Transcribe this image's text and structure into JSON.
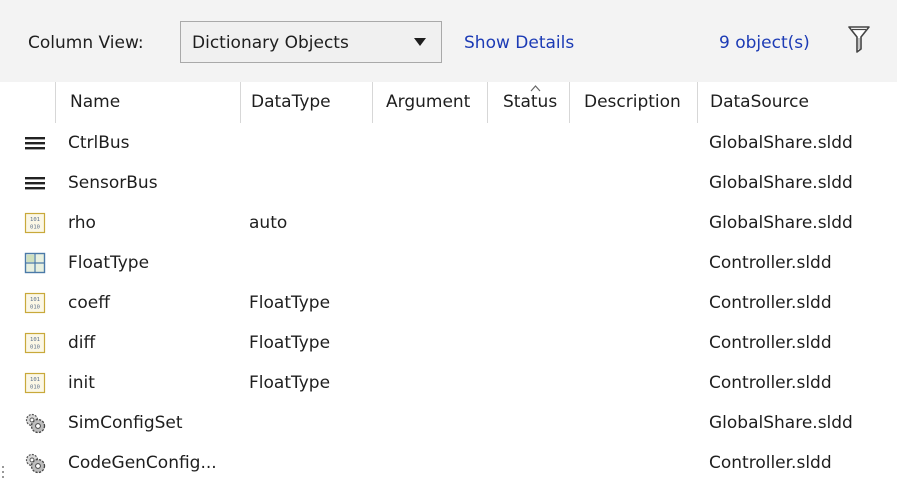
{
  "toolbar": {
    "column_view_label": "Column View:",
    "column_view_value": "Dictionary Objects",
    "show_details": "Show Details",
    "object_count": "9 object(s)",
    "filter_icon": "filter-icon"
  },
  "columns": [
    "Name",
    "DataType",
    "Argument",
    "Status",
    "Description",
    "DataSource"
  ],
  "sorted_column": "Status",
  "rows": [
    {
      "icon": "bus-icon",
      "name": "CtrlBus",
      "datatype": "",
      "argument": "",
      "status": "",
      "description": "",
      "datasource": "GlobalShare.sldd"
    },
    {
      "icon": "bus-icon",
      "name": "SensorBus",
      "datatype": "",
      "argument": "",
      "status": "",
      "description": "",
      "datasource": "GlobalShare.sldd"
    },
    {
      "icon": "parameter-icon",
      "name": "rho",
      "datatype": "auto",
      "argument": "",
      "status": "",
      "description": "",
      "datasource": "GlobalShare.sldd"
    },
    {
      "icon": "alias-type-icon",
      "name": "FloatType",
      "datatype": "",
      "argument": "",
      "status": "",
      "description": "",
      "datasource": "Controller.sldd"
    },
    {
      "icon": "parameter-icon",
      "name": "coeff",
      "datatype": "FloatType",
      "argument": "",
      "status": "",
      "description": "",
      "datasource": "Controller.sldd"
    },
    {
      "icon": "parameter-icon",
      "name": "diff",
      "datatype": "FloatType",
      "argument": "",
      "status": "",
      "description": "",
      "datasource": "Controller.sldd"
    },
    {
      "icon": "parameter-icon",
      "name": "init",
      "datatype": "FloatType",
      "argument": "",
      "status": "",
      "description": "",
      "datasource": "Controller.sldd"
    },
    {
      "icon": "config-set-icon",
      "name": "SimConfigSet",
      "datatype": "",
      "argument": "",
      "status": "",
      "description": "",
      "datasource": "GlobalShare.sldd"
    },
    {
      "icon": "config-set-icon",
      "name": "CodeGenConfig...",
      "datatype": "",
      "argument": "",
      "status": "",
      "description": "",
      "datasource": "Controller.sldd"
    }
  ],
  "colors": {
    "link": "#1c3bb5",
    "toolbar_bg": "#f3f3f3",
    "grid_line": "#d7d7d7",
    "parameter_icon": "#c8a93a",
    "alias_icon": "#4b7aa8"
  }
}
